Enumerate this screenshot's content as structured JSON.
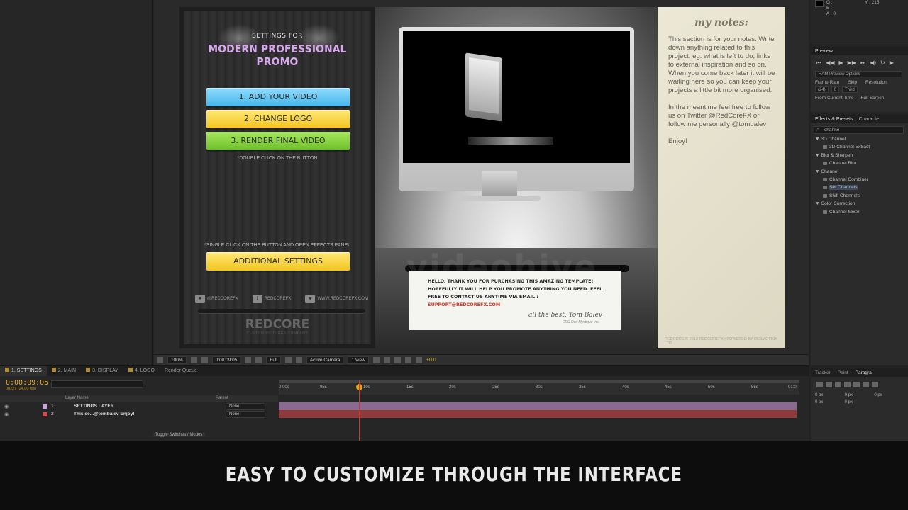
{
  "settings_panel": {
    "heading": "SETTINGS FOR",
    "title": "MODERN PROFESSIONAL PROMO",
    "buttons": [
      "1. ADD YOUR VIDEO",
      "2. CHANGE LOGO",
      "3. RENDER FINAL VIDEO"
    ],
    "double_click_note": "*DOUBLE CLICK ON THE BUTTON",
    "single_click_note": "*SINGLE CLICK ON THE BUTTON AND OPEN EFFECTS PANEL",
    "additional_button": "ADDITIONAL SETTINGS",
    "social": [
      "@REDCOREFX",
      "REDCOREFX",
      "WWW.REDCOREFX.COM"
    ],
    "logo": "REDCORE",
    "logo_sub": "CUSTOM PICTURES COMPANY"
  },
  "message_card": {
    "text": "HELLO, THANK YOU FOR PURCHASING THIS AMAZING TEMPLATE! HOPEFULLY IT WILL HELP YOU PROMOTE ANYTHING YOU NEED. FEEL FREE TO CONTACT US ANYTIME VIA EMAIL :",
    "email": "SUPPORT@REDCOREFX.COM",
    "signoff": "all the best, Tom Balev",
    "signoff_sub": "CEO Red Mystique Inc."
  },
  "notes": {
    "title": "my notes:",
    "paragraphs": [
      "This section is for your notes. Write down anything related to this project, eg. what is left to do, links to external inspiration and so on. When you come back later it will be waiting here so you can keep your projects a little bit more organised.",
      "In the meantime feel free to follow us on Twitter @RedCoreFX or follow me personally @tombalev",
      "Enjoy!"
    ],
    "footer": "REDCORE © 2013 REDCOREFX | POWERED BY DESMOTION LTD."
  },
  "watermark": "videohive",
  "viewer_toolbar": {
    "zoom": "100%",
    "timecode": "0:00:09:05",
    "resolution": "Full",
    "camera": "Active Camera",
    "view": "1 View",
    "exposure": "+0.0"
  },
  "info_panel": {
    "values": [
      "G :",
      "B :",
      "A : 0"
    ],
    "y": "Y : 215"
  },
  "preview_panel": {
    "tab": "Preview",
    "ram_preview": "RAM Preview Options",
    "labels": [
      "Frame Rate",
      "Skip",
      "Resolution"
    ],
    "values": [
      "(24)",
      "0",
      "Third"
    ],
    "checks": [
      "From Current Time",
      "Full Screen"
    ]
  },
  "effects_panel": {
    "tabs": [
      "Effects & Presets",
      "Characte"
    ],
    "search": "channe",
    "tree": [
      {
        "type": "cat",
        "label": "▼ 3D Channel"
      },
      {
        "type": "item",
        "label": "3D Channel Extract"
      },
      {
        "type": "cat",
        "label": "▼ Blur & Sharpen"
      },
      {
        "type": "item",
        "label": "Channel Blur"
      },
      {
        "type": "cat",
        "label": "▼ Channel"
      },
      {
        "type": "item",
        "label": "Channel Combiner"
      },
      {
        "type": "item",
        "label": "Set Channels",
        "selected": true
      },
      {
        "type": "item",
        "label": "Shift Channels"
      },
      {
        "type": "cat",
        "label": "▼ Color Correction"
      },
      {
        "type": "item",
        "label": "Channel Mixer"
      }
    ]
  },
  "timeline": {
    "tabs": [
      "1. SETTINGS",
      "2. MAIN",
      "3. DISPLAY",
      "4. LOGO",
      "Render Queue"
    ],
    "timecode": "0:00:09:05",
    "frames": "00221 (24.00 fps)",
    "header_layer": "Layer Name",
    "header_parent": "Parent",
    "layers": [
      {
        "num": "1",
        "name": "SETTINGS LAYER",
        "parent": "None",
        "color": "#c9a3d8"
      },
      {
        "num": "2",
        "name": "This se...@tombalev  Enjoy!",
        "parent": "None",
        "color": "#d84a4a"
      }
    ],
    "ruler": [
      "0:00s",
      "05s",
      "10s",
      "15s",
      "20s",
      "25s",
      "30s",
      "35s",
      "40s",
      "45s",
      "50s",
      "55s",
      "01:0"
    ],
    "toggle": "Toggle Switches / Modes"
  },
  "para_panel": {
    "tabs": [
      "Tracker",
      "Paint",
      "Paragra"
    ],
    "values": [
      "0 px",
      "0 px",
      "0 px",
      "0 px",
      "0 px",
      ""
    ]
  },
  "caption": "EASY TO CUSTOMIZE THROUGH THE INTERFACE"
}
